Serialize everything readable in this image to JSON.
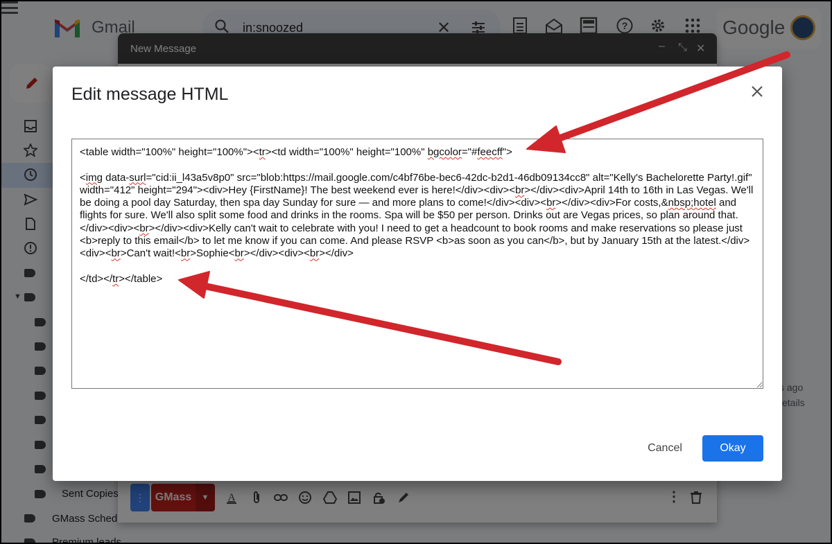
{
  "header": {
    "app_name": "Gmail",
    "search_query": "in:snoozed",
    "brand_word": "Google"
  },
  "compose": {
    "title": "New Message",
    "gmass_label": "GMass"
  },
  "sidebar": {
    "sent_copies": "Sent Copies",
    "gmass_scheduled": "GMass Sched",
    "premium_leads": "Premium leads"
  },
  "background_right": {
    "time_fragment": "s ago",
    "details_fragment": "etails"
  },
  "dialog": {
    "title": "Edit message HTML",
    "cancel_label": "Cancel",
    "okay_label": "Okay",
    "html_parts": {
      "p01": "<table width=\"100%\" height=\"100%\"><",
      "p02": "tr",
      "p03": "><td width=\"100%\" height=\"100%\" ",
      "p04": "bgcolor",
      "p05": "=\"#",
      "p06": "feecff",
      "p07": "\">\n\n<",
      "p08": "img",
      "p09": " data-",
      "p10": "surl",
      "p11": "=\"cid:ii_l43a5v8p0\" src=\"blob:https://mail.google.com/c4bf76be-bec6-42dc-b2d1-46db09134cc8\" alt=\"Kelly's Bachelorette Party!.gif\" width=\"412\" height=\"294\"><div>Hey {FirstName}! The best weekend ever is here!</div><div><",
      "p12": "br",
      "p13": "></div><div>April 14th to 16th in Las Vegas. We'll be doing a pool day Saturday, then spa day Sunday for sure — and more plans to come!</div><div><",
      "p14": "br",
      "p15": "></div><div>For costs,&",
      "p16": "nbsp;hotel",
      "p17": " and flights for sure. We'll also split some food and drinks in the rooms. Spa will be $50 per person. Drinks out are Vegas prices, so plan around that.</div><div><",
      "p18": "br",
      "p19": "></div><div>Kelly can't wait to celebrate with you! I need to get a headcount to book rooms and make reservations so please just <b>reply to this email</b> to let me know if you can come. And please RSVP <b>as soon as you can</b>, but by January 15th at the latest.</div><div><",
      "p20": "br",
      "p21": ">Can't wait!<",
      "p22": "br",
      "p23": ">Sophie<",
      "p24": "br",
      "p25": "></div><div><",
      "p26": "br",
      "p27": "></div>\n\n</td></",
      "p28": "tr",
      "p29": "></table>"
    }
  },
  "colors": {
    "accent_blue": "#1a73e8",
    "gmass_red": "#c5221f",
    "annotation_arrow": "#d1262b"
  }
}
